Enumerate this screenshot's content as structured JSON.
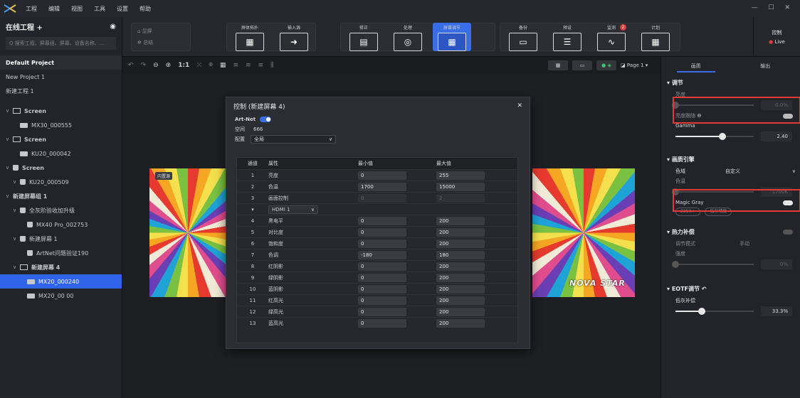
{
  "menubar": {
    "items": [
      "工程",
      "编辑",
      "视图",
      "工具",
      "设置",
      "帮助"
    ],
    "window_controls": "— ☐ ✕"
  },
  "leftpanel": {
    "title": "在线工程 +",
    "search_placeholder": "Q 搜索工程、屏幕组、屏幕、设备名称、...",
    "projects": [
      "Default Project",
      "New Project 1",
      "新建工程 1"
    ],
    "tree": [
      {
        "label": "Screen",
        "kind": "screen",
        "level": 0
      },
      {
        "label": "MX30_000555",
        "kind": "card",
        "level": 1
      },
      {
        "label": "Screen",
        "kind": "screen",
        "level": 0
      },
      {
        "label": "KU20_000042",
        "kind": "card",
        "level": 1
      },
      {
        "label": "Screen",
        "kind": "lock",
        "level": 0
      },
      {
        "label": "KU20_000509",
        "kind": "lock",
        "level": 1
      },
      {
        "label": "新建屏幕组 1",
        "kind": "none",
        "level": 0
      },
      {
        "label": "全灰阶验收加升级",
        "kind": "lock",
        "level": 1
      },
      {
        "label": "MX40 Pro_002753",
        "kind": "lock",
        "level": 2
      },
      {
        "label": "新建屏幕 1",
        "kind": "lock",
        "level": 1
      },
      {
        "label": "ArtNet问题验证190",
        "kind": "lock",
        "level": 2
      },
      {
        "label": "新建屏幕 4",
        "kind": "screen",
        "level": 1
      },
      {
        "label": "MX20_000240",
        "kind": "card",
        "level": 2,
        "selected": true
      },
      {
        "label": "MX20_00 00",
        "kind": "card",
        "level": 2
      }
    ]
  },
  "toolbar": {
    "side_items": [
      "显屏",
      "总结"
    ],
    "buttons": [
      {
        "label": "屏体拓扑",
        "icon": "grid-icon"
      },
      {
        "label": "输入源",
        "icon": "arrow-right-icon"
      },
      {
        "label": "修正",
        "icon": "correction-icon"
      },
      {
        "label": "处理",
        "icon": "color-wheel-icon"
      },
      {
        "label": "屏幕调节",
        "icon": "screen-adjust-icon",
        "active": true
      },
      {
        "label": "备份",
        "icon": "backup-icon"
      },
      {
        "label": "预设",
        "icon": "preset-icon"
      },
      {
        "label": "监测",
        "icon": "monitor-icon",
        "badge": "2"
      },
      {
        "label": "计划",
        "icon": "schedule-icon"
      }
    ],
    "control_label": "控制",
    "live_label": "Live"
  },
  "canvas": {
    "zoom_label": "1:1",
    "page_label": "Page 1",
    "screen_tag": "内置源",
    "watermark": "NOVA STAR"
  },
  "dialog": {
    "title": "控制 (新建屏幕 4)",
    "artnet_label": "Art-Net",
    "space_label": "空间",
    "space_value": "666",
    "config_label": "配置",
    "config_value": "全局",
    "headers": [
      "通道",
      "属性",
      "最小值",
      "最大值"
    ],
    "rows": [
      {
        "ch": "1",
        "prop": "亮度",
        "min": "0",
        "max": "255"
      },
      {
        "ch": "2",
        "prop": "色温",
        "min": "1700",
        "max": "15000"
      },
      {
        "ch": "3",
        "prop": "画面控制",
        "min": "0",
        "max": "2",
        "disabled": true
      },
      {
        "ch": "",
        "prop": "HDMI 1",
        "min": "",
        "max": "",
        "group": true
      },
      {
        "ch": "4",
        "prop": "黑电平",
        "min": "0",
        "max": "200"
      },
      {
        "ch": "5",
        "prop": "对比度",
        "min": "0",
        "max": "200"
      },
      {
        "ch": "6",
        "prop": "饱和度",
        "min": "0",
        "max": "200"
      },
      {
        "ch": "7",
        "prop": "色调",
        "min": "-180",
        "max": "180"
      },
      {
        "ch": "8",
        "prop": "红阴影",
        "min": "0",
        "max": "200"
      },
      {
        "ch": "9",
        "prop": "绿阴影",
        "min": "0",
        "max": "200"
      },
      {
        "ch": "10",
        "prop": "蓝阴影",
        "min": "0",
        "max": "200"
      },
      {
        "ch": "11",
        "prop": "红高光",
        "min": "0",
        "max": "200"
      },
      {
        "ch": "12",
        "prop": "绿高光",
        "min": "0",
        "max": "200"
      },
      {
        "ch": "13",
        "prop": "蓝高光",
        "min": "0",
        "max": "200"
      }
    ]
  },
  "rightpanel": {
    "tabs": [
      "画质",
      "输出"
    ],
    "sec_adjust": "调节",
    "brightness_label": "亮度",
    "brightness_value": "0.0%",
    "brightness_level": 0,
    "brightness_follow_label": "亮度跟随 ❶",
    "gamma_label": "Gamma",
    "gamma_value": "2.40",
    "gamma_level": 0.6,
    "sec_engine": "画质引擎",
    "gamut_label": "色域",
    "gamut_value": "自定义",
    "colortemp_label": "色温",
    "colortemp_value": "1700K",
    "colortemp_level": 0,
    "magic_gray_label": "Magic Gray",
    "pill_1": "22bit+",
    "pill_2": "低灰精度",
    "sec_heat": "热力补偿",
    "heat_mode_label": "调节模式",
    "heat_mode_value": "手动",
    "heat_strength_label": "强度",
    "heat_value": "0%",
    "heat_level": 0,
    "sec_eotf": "EOTF调节",
    "lowgray_label": "低灰补偿",
    "lowgray_value": "33.3%",
    "lowgray_level": 0.333,
    "accent": "#3a6ee8",
    "highlight": "#e53935"
  }
}
